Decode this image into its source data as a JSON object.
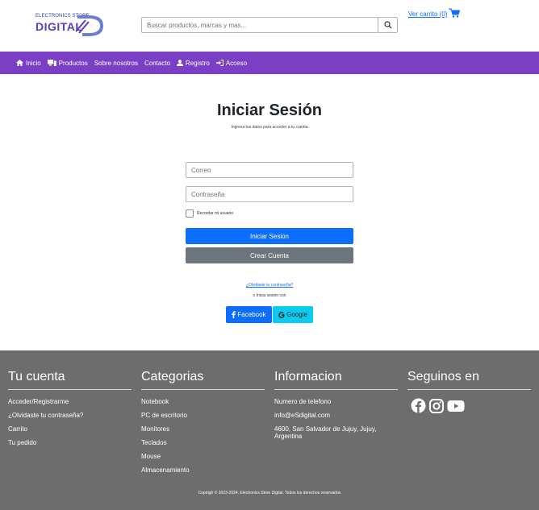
{
  "header": {
    "logo_top": "ELECTRONICS STORE",
    "logo_main": "DIGITAL",
    "search_placeholder": "Buscar productos, marcas y mas...",
    "cart_label": "Ver carrito (0)"
  },
  "nav": {
    "items": [
      {
        "label": "Inicio",
        "icon": "home-icon"
      },
      {
        "label": "Productos",
        "icon": "devices-icon"
      },
      {
        "label": "Sobre nosotros",
        "icon": ""
      },
      {
        "label": "Contacto",
        "icon": ""
      },
      {
        "label": "Registro",
        "icon": "user-icon"
      },
      {
        "label": "Acceso",
        "icon": "sign-in-icon"
      }
    ]
  },
  "login": {
    "title": "Iniciar Sesión",
    "subtitle": "Ingresa tus datos para acceder a tu cuenta",
    "email_placeholder": "Correo",
    "password_placeholder": "Contraseña",
    "remember_label": "Recordar mi usuario",
    "login_button": "Iniciar Sesion",
    "create_button": "Crear Cuenta",
    "forgot_link": "¿Olvidaste tu contraseña?",
    "or_text": "o Inicia sesión con",
    "facebook_button": "Facebook",
    "google_button": "Google"
  },
  "footer": {
    "account": {
      "title": "Tu cuenta",
      "links": [
        "Acceder/Registrarme",
        "¿Olvidaste tu contraseña?",
        "Carrito",
        "Tu pedido"
      ]
    },
    "categories": {
      "title": "Categorias",
      "links": [
        "Notebook",
        "PC de escritorio",
        "Monitores",
        "Teclados",
        "Mouse",
        "Almacenamiento"
      ]
    },
    "info": {
      "title": "Informacion",
      "lines": [
        "Numero de telefono",
        "info@eSdigital.com",
        "4600, San Salvador de Jujuy, Jujuy, Argentina"
      ]
    },
    "social": {
      "title": "Seguinos en",
      "icons": [
        "facebook-icon",
        "instagram-icon",
        "youtube-icon"
      ]
    },
    "copyright": "Copirigh © 2023-2024. Electronics Store Digital. Todos los derechos reservados"
  },
  "colors": {
    "nav_bg": "#7b3fc6",
    "primary": "#0d6efd",
    "secondary": "#6c757d",
    "google": "#0dcaf0",
    "footer_bg": "#6d6d6d"
  }
}
